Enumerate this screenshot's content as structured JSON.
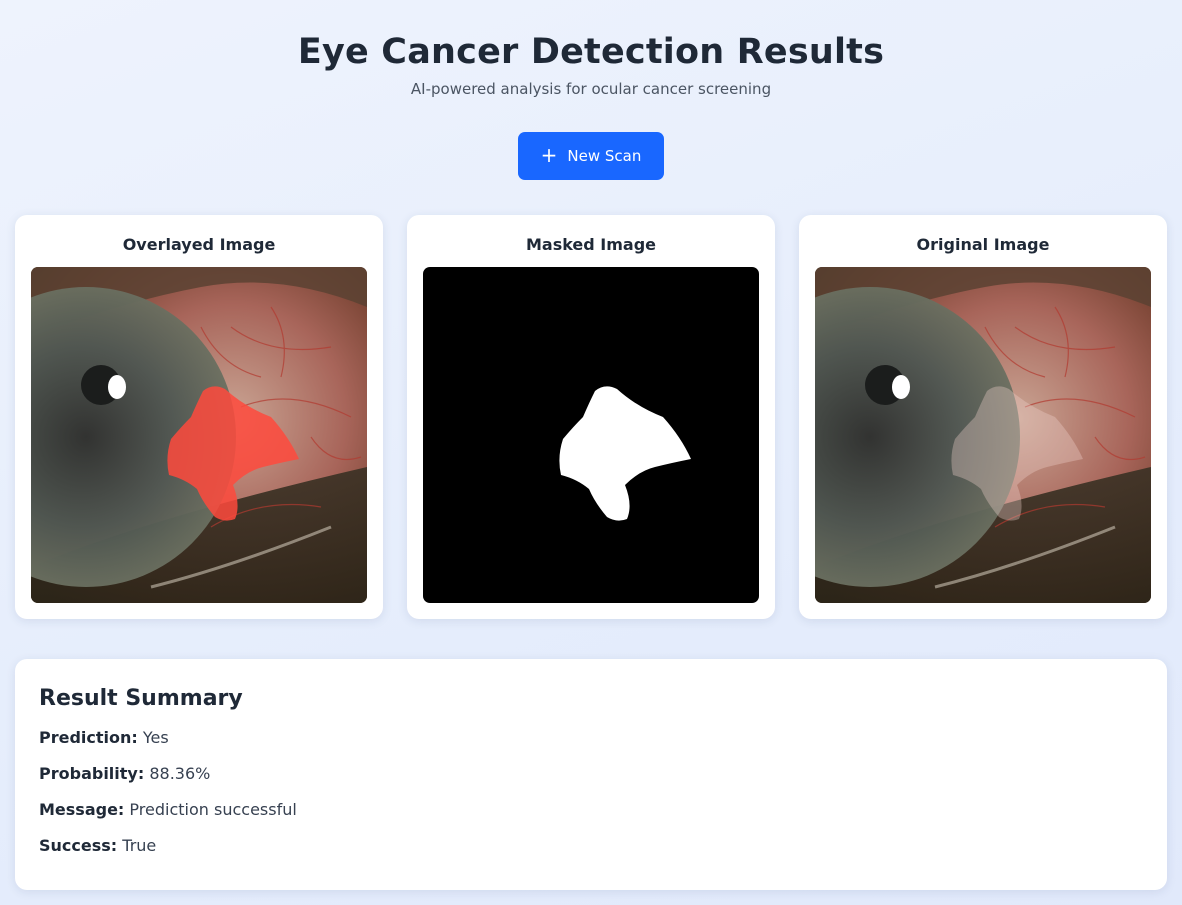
{
  "header": {
    "title": "Eye Cancer Detection Results",
    "subtitle": "AI-powered analysis for ocular cancer screening"
  },
  "actions": {
    "new_scan_label": "New Scan",
    "new_scan_icon": "plus-icon",
    "accent_color": "#1967ff"
  },
  "images": [
    {
      "title": "Overlayed Image"
    },
    {
      "title": "Masked Image"
    },
    {
      "title": "Original Image"
    }
  ],
  "summary": {
    "title": "Result Summary",
    "rows": [
      {
        "label": "Prediction:",
        "value": "Yes"
      },
      {
        "label": "Probability:",
        "value": "88.36%"
      },
      {
        "label": "Message:",
        "value": "Prediction successful"
      },
      {
        "label": "Success:",
        "value": "True"
      }
    ]
  },
  "colors": {
    "overlay_highlight": "#ff4a3d",
    "mask_background": "#000000",
    "mask_foreground": "#ffffff"
  }
}
